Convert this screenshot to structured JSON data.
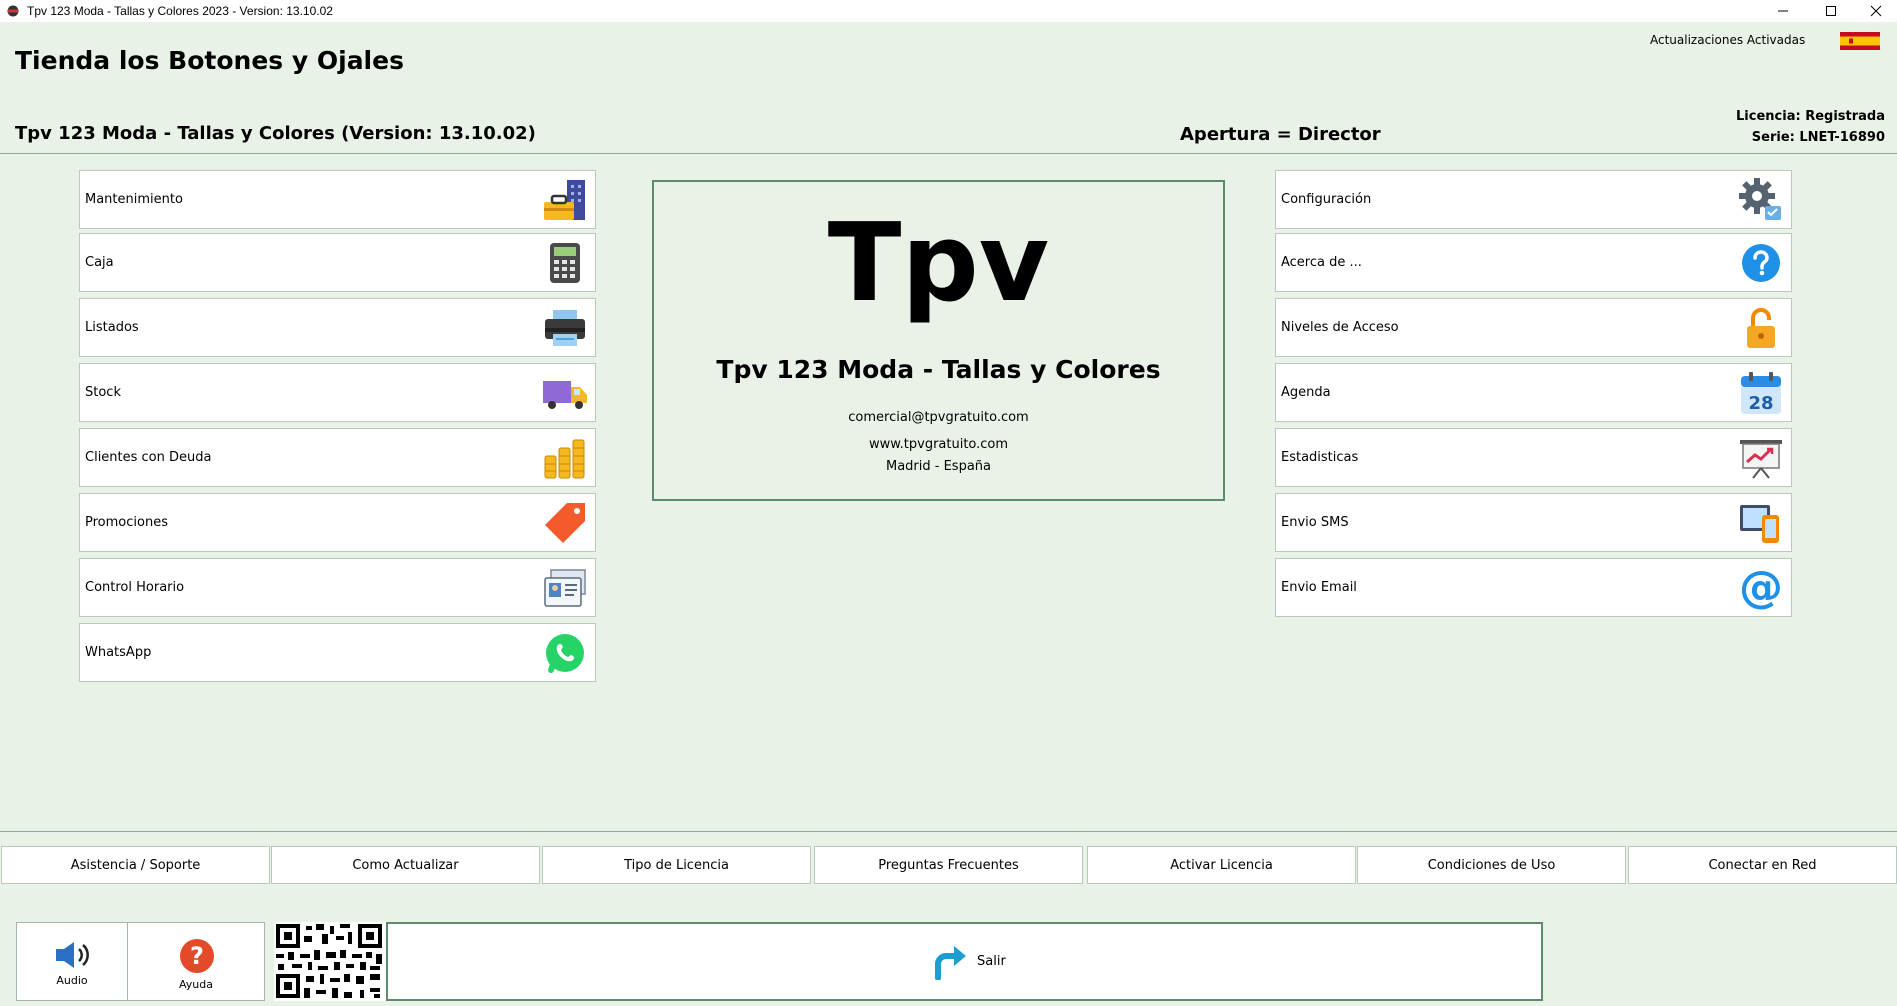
{
  "window": {
    "title": "Tpv 123 Moda - Tallas y Colores  2023 -  Version: 13.10.02",
    "minimize_label": "—",
    "maximize_label": "□",
    "close_label": "✕"
  },
  "header": {
    "shop_name": "Tienda los Botones y Ojales",
    "updates": "Actualizaciones Activadas",
    "flag_icon": "spain-flag-icon",
    "license_line": "Licencia: Registrada",
    "serial_line": "Serie: LNET-16890",
    "version_line": "Tpv 123 Moda - Tallas y Colores (Version: 13.10.02)",
    "apertura_line": "Apertura = Director"
  },
  "left_menu": [
    {
      "label": "Mantenimiento",
      "icon": "toolbox-building-icon"
    },
    {
      "label": "Caja",
      "icon": "calculator-icon"
    },
    {
      "label": "Listados",
      "icon": "printer-icon"
    },
    {
      "label": "Stock",
      "icon": "delivery-truck-icon"
    },
    {
      "label": "Clientes con Deuda",
      "icon": "coin-stacks-icon"
    },
    {
      "label": "Promociones",
      "icon": "price-tag-icon"
    },
    {
      "label": "Control Horario",
      "icon": "id-card-icon"
    },
    {
      "label": "WhatsApp",
      "icon": "whatsapp-icon"
    }
  ],
  "right_menu": [
    {
      "label": "Configuración",
      "icon": "gear-icon"
    },
    {
      "label": "Acerca de ...",
      "icon": "question-icon"
    },
    {
      "label": "Niveles de Acceso",
      "icon": "padlock-icon"
    },
    {
      "label": "Agenda",
      "icon": "calendar-icon",
      "day": "28"
    },
    {
      "label": "Estadisticas",
      "icon": "chart-board-icon"
    },
    {
      "label": "Envio SMS",
      "icon": "tablet-phone-icon"
    },
    {
      "label": "Envio Email",
      "icon": "at-sign-icon"
    }
  ],
  "center": {
    "logo_text": "Tpv",
    "product": "Tpv 123 Moda - Tallas y Colores",
    "email": "comercial@tpvgratuito.com",
    "website": "www.tpvgratuito.com",
    "location": "Madrid - España"
  },
  "bottom_nav": [
    "Asistencia / Soporte",
    "Como Actualizar",
    "Tipo de Licencia",
    "Preguntas Frecuentes",
    "Activar Licencia",
    "Condiciones de Uso",
    "Conectar en Red"
  ],
  "footer": {
    "audio_label": "Audio",
    "help_label": "Ayuda",
    "help_glyph": "?",
    "exit_label": "Salir"
  },
  "colors": {
    "background": "#e9f2e7",
    "panel_border": "#5e8b69",
    "exit_arrow": "#1a9fd0",
    "help_red": "#e24a2a",
    "whatsapp_green": "#25d366"
  }
}
